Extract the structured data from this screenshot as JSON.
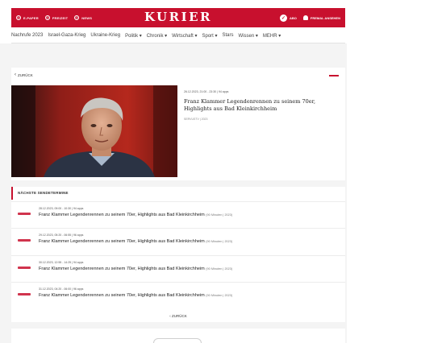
{
  "header": {
    "left_links": [
      {
        "label": "E-PAPER",
        "icon": "epaper-icon"
      },
      {
        "label": "FREIZEIT",
        "icon": "freizeit-icon"
      },
      {
        "label": "NEWS",
        "icon": "news-icon"
      }
    ],
    "logo": "KURIER",
    "right_links": [
      {
        "label": "ABO",
        "icon": "abo-icon"
      },
      {
        "label": "FREMAL ANSEHEN",
        "icon": "user-icon"
      }
    ],
    "brand_color": "#c8102e"
  },
  "nav": {
    "items": [
      "Nachrufe 2023",
      "Israel-Gaza-Krieg",
      "Ukraine-Krieg",
      "Politik ▾",
      "Chronik ▾",
      "Wirtschaft ▾",
      "Sport ▾",
      "Stars",
      "Wissen ▾",
      "MEHR ▾"
    ]
  },
  "main": {
    "back_label": "ZURÜCK",
    "video": {
      "date": "26.12.2023, 21:00 - 23:30 | 94 apps",
      "title": "Franz Klammer Legendenrennen zu seinem 70er, Highlights aus Bad Kleinkirchheim",
      "source": "SERVUSTV | 2023"
    }
  },
  "next_dates": {
    "heading": "NÄCHSTE SENDETERMINE",
    "rows": [
      {
        "date": "28.12.2023, 09:00 - 10:30 | 94 apps",
        "title": "Franz Klammer Legendenrennen zu seinem 70er, Highlights aus Bad Kleinkirchheim",
        "source": "(90 Minuten | 2023)"
      },
      {
        "date": "29.12.2023, 05:20 - 06:55 | 96 apps",
        "title": "Franz Klammer Legendenrennen zu seinem 70er, Highlights aus Bad Kleinkirchheim",
        "source": "(90 Minuten | 2023)"
      },
      {
        "date": "30.12.2023, 12:55 - 14:25 | 94 apps",
        "title": "Franz Klammer Legendenrennen zu seinem 70er, Highlights aus Bad Kleinkirchheim",
        "source": "(90 Minuten | 2023)"
      },
      {
        "date": "31.12.2023, 04:20 - 06:00 | 96 apps",
        "title": "Franz Klammer Legendenrennen zu seinem 70er, Highlights aus Bad Kleinkirchheim",
        "source": "(90 Minuten | 2023)"
      }
    ],
    "back_label": "ZURÜCK"
  }
}
